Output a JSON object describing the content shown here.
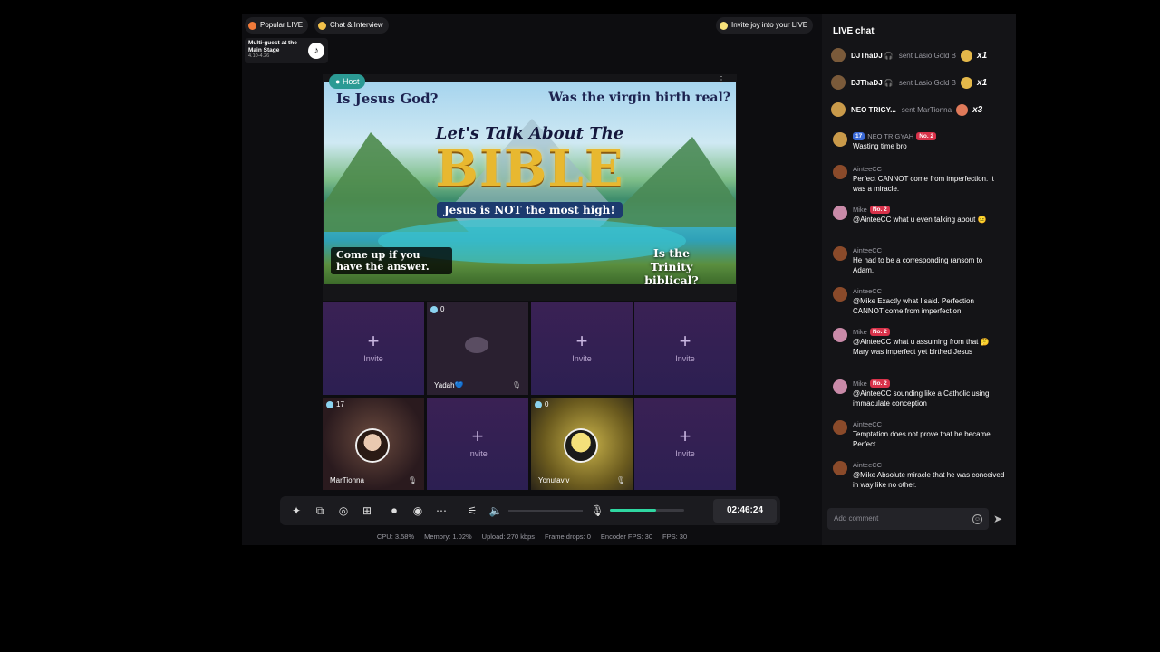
{
  "top": {
    "popular_live": "Popular LIVE",
    "chat_interview": "Chat & Interview",
    "invite_joy": "Invite joy into your LIVE",
    "event_title": "Multi-guest at the Main Stage",
    "event_dates": "4.10-4.26"
  },
  "host": {
    "badge": "Host",
    "banner": {
      "q1": "Is Jesus God?",
      "q2": "Was the virgin birth real?",
      "lets_talk": "Let's Talk About The",
      "bible": "BIBLE",
      "jesus_line": "Jesus is NOT the most high!",
      "come_up": "Come up if you have the answer.",
      "trinity": "Is the Trinity biblical?"
    }
  },
  "slots": {
    "invite_label": "Invite",
    "plus": "+",
    "guest1": {
      "count": "0",
      "name": "Yadah💙"
    },
    "guest2": {
      "count": "17",
      "name": "MarTionna"
    },
    "guest3": {
      "count": "0",
      "name": "Yonutaviv"
    }
  },
  "controls": {
    "timer": "02:46:24",
    "mic_level": 0.62
  },
  "stats": {
    "cpu": "CPU: 3.58%",
    "memory": "Memory: 1.02%",
    "upload": "Upload: 270 kbps",
    "frame_drops": "Frame drops: 0",
    "encoder_fps": "Encoder FPS: 30",
    "fps": "FPS: 30"
  },
  "chat": {
    "title": "LIVE chat",
    "gifts": [
      {
        "name": "DJThaDJ 🎧",
        "text": "sent Lasio Gold B",
        "mult": "x1"
      },
      {
        "name": "DJThaDJ 🎧",
        "text": "sent Lasio Gold B",
        "mult": "x1"
      },
      {
        "name": "NEO TRIGY...",
        "text": "sent MarTionna",
        "mult": "x3"
      }
    ],
    "messages": [
      {
        "author": "NEO TRIGYAH",
        "level": "17",
        "rank": "No. 2",
        "text": "Wasting time bro"
      },
      {
        "author": "AinteeCC",
        "text": "Perfect CANNOT come from imperfection. It was a miracle."
      },
      {
        "author": "Mike",
        "rank": "No. 2",
        "text": "@AinteeCC what u even talking about 😐"
      },
      {
        "author": "AinteeCC",
        "text": "He had to be a corresponding ransom to Adam."
      },
      {
        "author": "AinteeCC",
        "text": "@Mike Exactly what I said. Perfection CANNOT come from imperfection."
      },
      {
        "author": "Mike",
        "rank": "No. 2",
        "text": "@AinteeCC what u assuming from that 🤔 Mary was imperfect yet birthed Jesus"
      },
      {
        "author": "Mike",
        "rank": "No. 2",
        "text": "@AinteeCC sounding like a Catholic using immaculate conception"
      },
      {
        "author": "AinteeCC",
        "text": "Temptation does not prove that he became Perfect."
      },
      {
        "author": "AinteeCC",
        "text": "@Mike Absolute miracle that he was conceived in way like no other."
      }
    ],
    "comment_placeholder": "Add comment"
  }
}
